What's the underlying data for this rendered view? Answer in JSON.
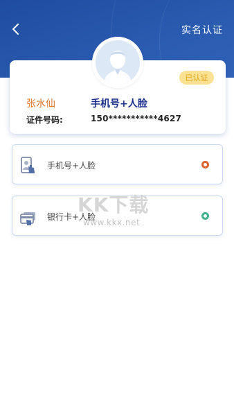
{
  "header": {
    "title": "实名认证",
    "back_icon": "back-arrow-icon"
  },
  "profile": {
    "avatar_icon": "user-avatar-icon",
    "status_badge": "已认证",
    "name": "张水仙",
    "auth_method": "手机号+人脸",
    "id_label": "证件号码:",
    "id_value": "150***********4627"
  },
  "options": [
    {
      "label": "手机号+人脸",
      "icon": "phone-face-icon",
      "radio_color": "#e0622d"
    },
    {
      "label": "银行卡+人脸",
      "icon": "bank-card-icon",
      "radio_color": "#3fb28d"
    }
  ],
  "watermark": {
    "text": "KK下载",
    "url": "www.kkx.net"
  },
  "colors": {
    "header_blue": "#2a5bb0",
    "name_orange": "#e0762e",
    "method_navy": "#1c2f8a",
    "badge_bg": "#fbe293",
    "badge_text": "#e6a31a"
  }
}
